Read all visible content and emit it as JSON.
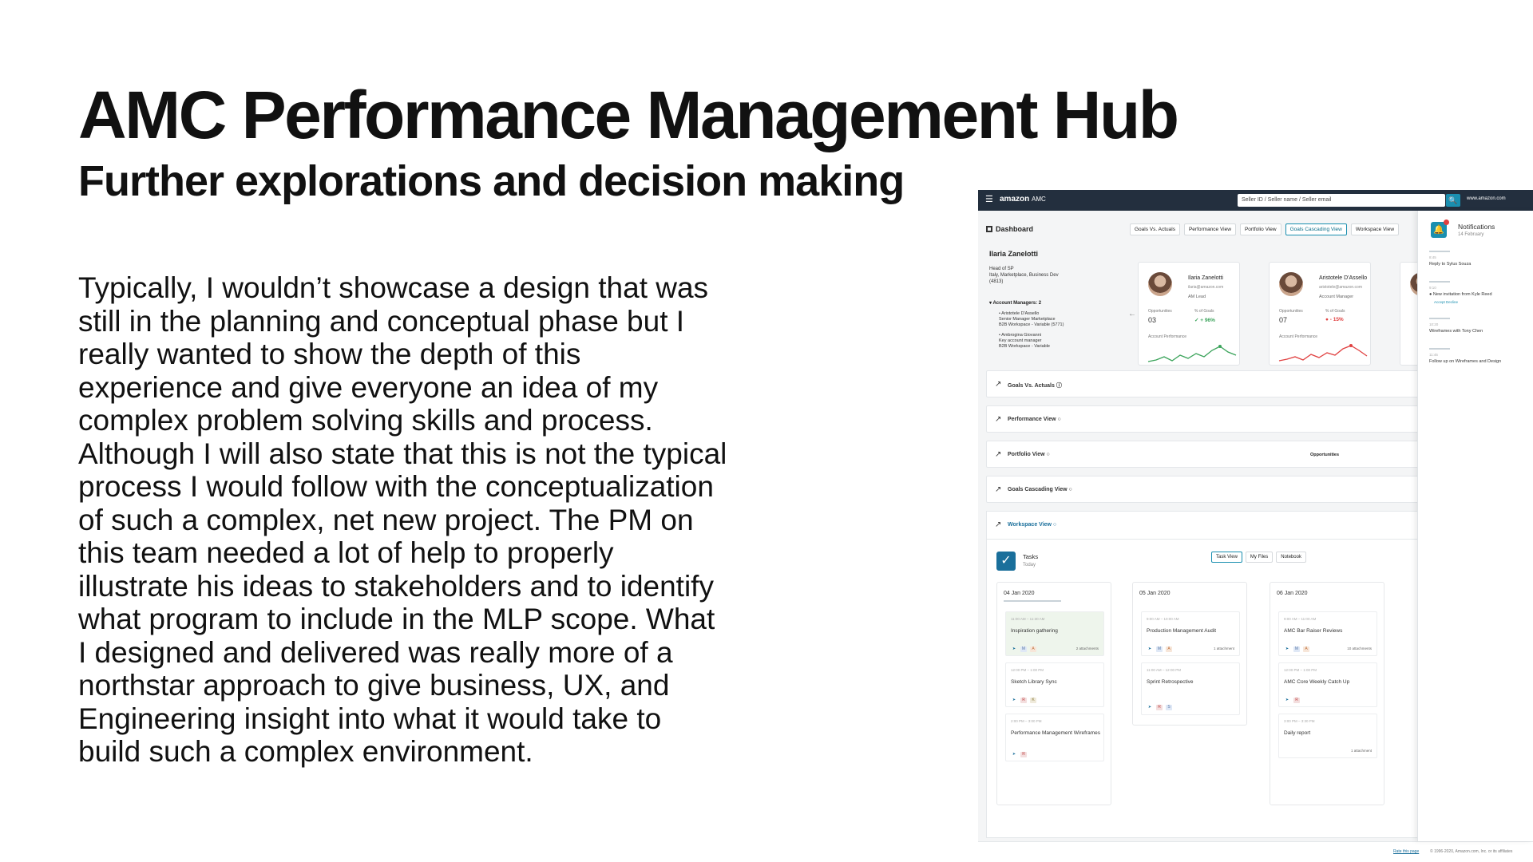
{
  "slide": {
    "title": "AMC Performance Management Hub",
    "subtitle": "Further explorations and decision making",
    "body": "Typically, I wouldn’t showcase a design that was\nstill in the planning and conceptual phase but I\nreally wanted to show the depth of this\nexperience and give everyone an idea of my\ncomplex problem solving skills and process.\nAlthough I will also state that this is not the typical\nprocess I would follow with the conceptualization\nof such a complex, net new project. The PM on\nthis team needed a lot of help to properly\nillustrate his ideas to stakeholders and to identify\nwhat program to include in the MLP scope. What\nI designed and delivered was really more of a\nnorthstar approach to give business, UX, and\nEngineering insight into what it would take to\nbuild such a complex environment."
  },
  "mock": {
    "topbar": {
      "menu_glyph": "☰",
      "brand": "amazon",
      "brand_suffix": "AMC",
      "search_value": "Seller ID / Seller name / Seller email",
      "search_glyph": "🔍",
      "account": "www.amazon.com"
    },
    "dashboard_label": "Dashboard",
    "tabs": [
      "Goals Vs. Actuals",
      "Performance View",
      "Portfolio View",
      "Goals Cascading View",
      "Workspace View"
    ],
    "person": {
      "name": "Ilaria Zanelotti",
      "meta": "Head of SP\nItaly, Marketplace, Business Dev\n(4813)",
      "am_label": "▾ Account Managers: 2",
      "am_list": [
        "• Aristotele D'Assello\nSenior Manager Marketplace\nB2B Workspace - Variable (5771)",
        "• Ambrogina Giovanni\nKey account manager\nB2B Workspace - Variable"
      ],
      "back_glyph": "←"
    },
    "cards": [
      {
        "name": "Ilaria Zanelotti",
        "email": "ilaria@amazon.com",
        "role": "AM Lead",
        "metric_label": "Opportunities",
        "metric_value": "03",
        "pct_label": "% of Goals",
        "pct": "✓ + 96%",
        "chart_label": "Account Performance",
        "color": "#3aa35a"
      },
      {
        "name": "Aristotele D'Assello",
        "email": "aristotele@amazon.com",
        "role": "Account Manager",
        "metric_label": "Opportunities",
        "metric_value": "07",
        "pct_label": "% of Goals",
        "pct": "● - 15%",
        "chart_label": "Account Performance",
        "color": "#e04040"
      }
    ],
    "sections": [
      {
        "title": "Goals Vs. Actuals ⓘ",
        "blue": false
      },
      {
        "title": "Performance View ○",
        "blue": false
      },
      {
        "title": "Portfolio View ○",
        "blue": false
      },
      {
        "title": "Goals Cascading View ○",
        "blue": false
      },
      {
        "title": "Workspace View ○",
        "blue": true
      }
    ],
    "trend_glyph": "↗",
    "opportunities_label": "Opportunities",
    "workspace": {
      "check_glyph": "✓",
      "tasks_title": "Tasks",
      "tasks_sub": "Today",
      "view_tabs": [
        "Task View",
        "My Files",
        "Notebook"
      ],
      "columns": [
        {
          "date": "04 Jan 2020",
          "tasks": [
            {
              "time": "11:00 AM – 11:30 AM",
              "title": "Inspiration gathering",
              "attach": "2 attachments",
              "hl": true
            },
            {
              "time": "12:00 PM – 1:00 PM",
              "title": "Sketch Library Sync",
              "attach": ""
            },
            {
              "time": "2:00 PM – 3:00 PM",
              "title": "Performance Management Wireframes",
              "attach": ""
            }
          ]
        },
        {
          "date": "05 Jan 2020",
          "tasks": [
            {
              "time": "9:00 AM – 10:00 AM",
              "title": "Production Management Audit",
              "attach": "1 attachment"
            },
            {
              "time": "11:00 AM – 12:00 PM",
              "title": "Sprint Retrospective",
              "attach": ""
            }
          ]
        },
        {
          "date": "06 Jan 2020",
          "tasks": [
            {
              "time": "9:00 AM – 11:00 AM",
              "title": "AMC Bar Raiser Reviews",
              "attach": "10 attachments"
            },
            {
              "time": "12:00 PM – 1:00 PM",
              "title": "AMC Core Weekly Catch Up",
              "attach": ""
            },
            {
              "time": "3:00 PM – 3:30 PM",
              "title": "Daily report",
              "attach": "1 attachment"
            }
          ]
        }
      ]
    },
    "footer": {
      "link": "Rate this page",
      "copy": "© 1996-2020, Amazon.com, Inc. or its affiliates"
    },
    "notifications": {
      "bell_glyph": "🔔",
      "title": "Notifications",
      "date": "14 February",
      "items": [
        {
          "time": "8:45",
          "text": "Reply to Sylus Souza",
          "actions": ""
        },
        {
          "time": "9:10",
          "text": "● New invitation from Kyle Reed",
          "actions": "Accept     Decline"
        },
        {
          "time": "10:20",
          "text": "Wireframes with Tony Chen",
          "actions": ""
        },
        {
          "time": "11:45",
          "text": "Follow up on Wireframes and Design",
          "actions": ""
        }
      ]
    }
  }
}
